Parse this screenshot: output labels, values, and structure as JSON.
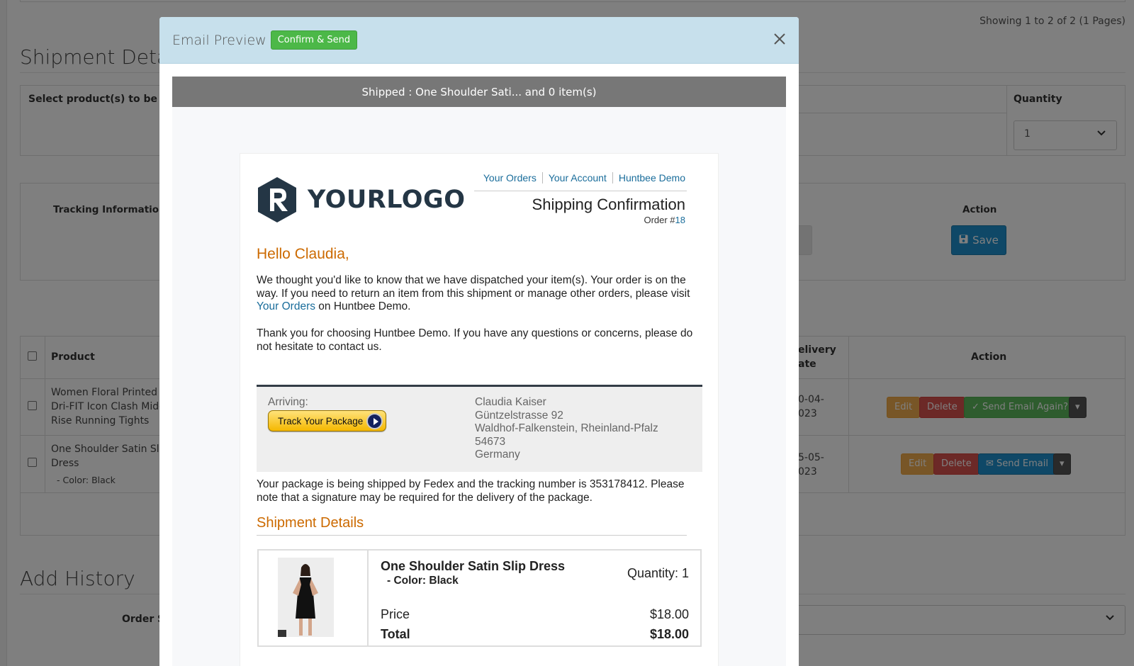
{
  "background": {
    "showing_text": "Showing 1 to 2 of 2 (1 Pages)",
    "shipment_details_heading": "Shipment Detai",
    "select_products_label": "Select product(s) to be sh",
    "quantity_header": "Quantity",
    "quantity_value": "1",
    "tracking_information_label": "Tracking Information",
    "action_header": "Action",
    "save_label": "Save",
    "table": {
      "product_header": "Product",
      "delivery_date_header": "elivery\nate",
      "action_header": "Action",
      "rows": [
        {
          "product": "Women Floral Printed\nDri-FIT Icon Clash Mid-\nRise Running Tights",
          "date": "0-04-\n023",
          "edit": "Edit",
          "delete": "Delete",
          "send": "Send Email Again?"
        },
        {
          "product": "One Shoulder Satin Sli\nDress",
          "option": "- Color: Black",
          "date": "5-05-\n023",
          "edit": "Edit",
          "delete": "Delete",
          "send": "Send Email"
        }
      ]
    },
    "add_history_heading": "Add History",
    "order_status_label": "Order S"
  },
  "modal": {
    "title": "Email Preview",
    "confirm_label": "Confirm & Send",
    "banner": "Shipped : One Shoulder Sati... and 0 item(s)"
  },
  "email": {
    "logo_text": "YOURLOGO",
    "links": [
      "Your Orders",
      "Your Account",
      "Huntbee Demo"
    ],
    "heading": "Shipping Confirmation",
    "order_prefix": "Order #",
    "order_number": "18",
    "greeting": "Hello Claudia,",
    "p1_before": "We thought you'd like to know that we have dispatched your item(s). Your order is on the way. If you need to return an item from this shipment or manage other orders, please visit ",
    "p1_link": "Your Orders",
    "p1_after": " on Huntbee Demo.",
    "p2": "Thank you for choosing Huntbee Demo. If you have any questions or concerns, please do not hesitate to contact us.",
    "arriving_label": "Arriving:",
    "track_button": "Track Your Package",
    "address_lines": [
      "Claudia Kaiser",
      "Güntzelstrasse 92",
      "Waldhof-Falkenstein, Rheinland-Pfalz",
      "54673",
      "Germany"
    ],
    "p3": "Your package is being shipped by Fedex and the tracking number is 353178412. Please note that a signature may be required for the delivery of the package.",
    "shipment_heading": "Shipment Details",
    "item": {
      "name": "One Shoulder Satin Slip Dress",
      "option": "- Color: Black",
      "quantity": "Quantity: 1",
      "price_label": "Price",
      "price": "$18.00",
      "total_label": "Total",
      "total": "$18.00"
    }
  },
  "colors": {
    "header_bg": "#c7e0ec",
    "confirm_green": "#4cb848",
    "banner_gray": "#777777",
    "orange_heading": "#cc6a00",
    "link_blue": "#1a6d9b",
    "logo_navy": "#243645"
  },
  "icons": {
    "close": "close-icon",
    "save": "floppy-disk-icon",
    "track": "play-arrow-icon",
    "dropdown": "chevron-down-icon"
  }
}
